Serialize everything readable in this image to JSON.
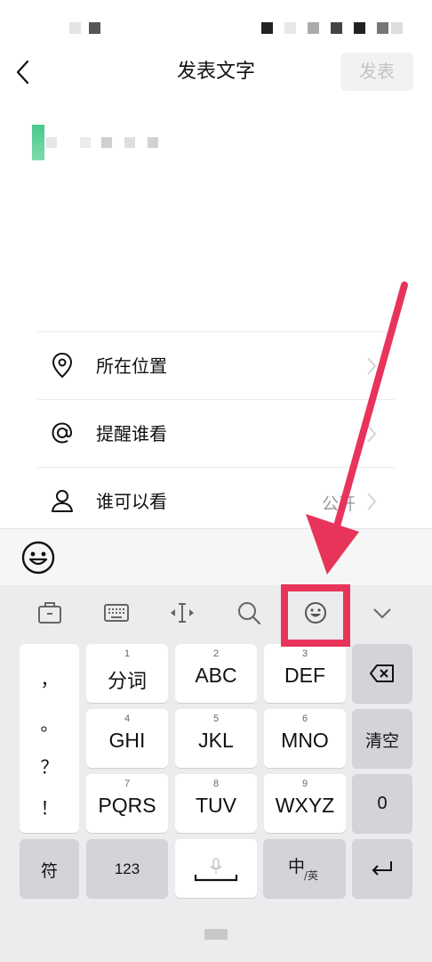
{
  "header": {
    "title": "发表文字",
    "post_label": "发表",
    "back_icon": "chevron-left-icon"
  },
  "options": [
    {
      "icon": "location-pin-icon",
      "label": "所在位置",
      "value": ""
    },
    {
      "icon": "at-sign-icon",
      "label": "提醒谁看",
      "value": ""
    },
    {
      "icon": "person-icon",
      "label": "谁可以看",
      "value": "公开"
    }
  ],
  "keyboard": {
    "toolbar": [
      "toolbox-icon",
      "keyboard-icon",
      "cursor-move-icon",
      "search-icon",
      "emoji-icon",
      "collapse-chevron-icon"
    ],
    "punctuation": [
      "，",
      "。",
      "？",
      "！"
    ],
    "rows": [
      [
        {
          "num": "1",
          "label": "分词"
        },
        {
          "num": "2",
          "label": "ABC"
        },
        {
          "num": "3",
          "label": "DEF"
        }
      ],
      [
        {
          "num": "4",
          "label": "GHI"
        },
        {
          "num": "5",
          "label": "JKL"
        },
        {
          "num": "6",
          "label": "MNO"
        }
      ],
      [
        {
          "num": "7",
          "label": "PQRS"
        },
        {
          "num": "8",
          "label": "TUV"
        },
        {
          "num": "9",
          "label": "WXYZ"
        }
      ]
    ],
    "side_keys": {
      "delete_icon": "backspace-icon",
      "clear": "清空",
      "zero": "0",
      "enter_icon": "enter-icon"
    },
    "bottom": {
      "symbols": "符",
      "numbers": "123",
      "space_icon": "microphone-icon",
      "lang_main": "中",
      "lang_sub": "/英"
    }
  },
  "colors": {
    "accent_red": "#e8345a",
    "cursor_green": "#48c98a"
  }
}
